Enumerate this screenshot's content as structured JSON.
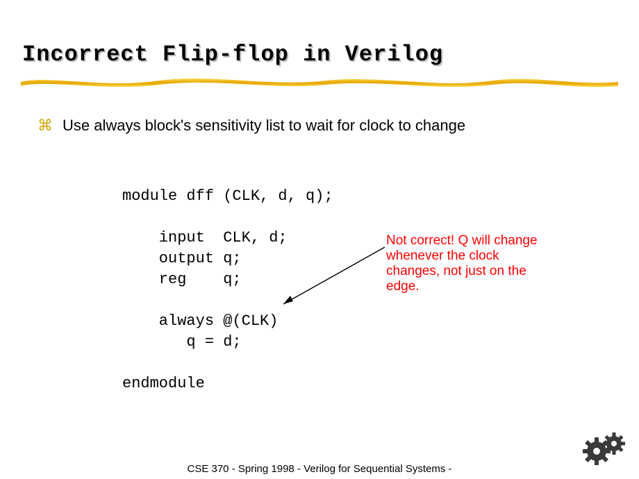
{
  "title": "Incorrect Flip-flop in Verilog",
  "bullet": {
    "glyph": "⌘",
    "text": "Use always block's sensitivity list to wait for clock to change"
  },
  "code": "module dff (CLK, d, q);\n\n    input  CLK, d;\n    output q;\n    reg    q;\n\n    always @(CLK)\n       q = d;\n\nendmodule",
  "annotation": "Not correct!  Q will change whenever the clock changes, not just on the edge.",
  "footer": "CSE 370 - Spring 1998 - Verilog for Sequential Systems -",
  "colors": {
    "highlight": "#f4c430",
    "annotation": "#ff0000",
    "bullet": "#d3a500"
  }
}
